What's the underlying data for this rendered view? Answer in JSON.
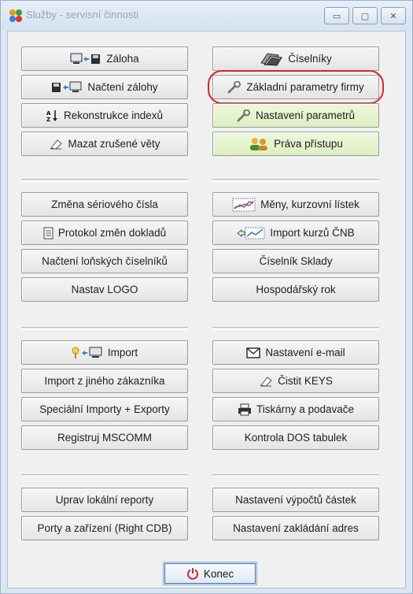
{
  "window": {
    "title": "Služby - servisní činnosti",
    "controls": {
      "minimize": "▭",
      "maximize": "▢",
      "close": "✕"
    }
  },
  "left_buttons": [
    {
      "name": "zaloha-button",
      "label": "Záloha",
      "icon": "computer-to-disk-icon"
    },
    {
      "name": "nacteni-zalohy-button",
      "label": "Načtení zálohy",
      "icon": "disk-to-computer-icon"
    },
    {
      "name": "rekonstrukce-indexu-button",
      "label": "Rekonstrukce indexů",
      "icon": "sort-az-icon"
    },
    {
      "name": "mazat-zrusene-vety-button",
      "label": "Mazat zrušené věty",
      "icon": "eraser-icon"
    },
    {
      "name": "zmena-serioveho-cisla-button",
      "label": "Změna sériového čísla",
      "icon": ""
    },
    {
      "name": "protokol-zmen-dokladu-button",
      "label": "Protokol změn dokladů",
      "icon": "document-icon"
    },
    {
      "name": "nacteni-lonskych-ciselniku-button",
      "label": "Načtení loňských číselníků",
      "icon": ""
    },
    {
      "name": "nastav-logo-button",
      "label": "Nastav LOGO",
      "icon": ""
    },
    {
      "name": "import-button",
      "label": "Import",
      "icon": "key-computer-icon"
    },
    {
      "name": "import-z-jineho-zakaznika-button",
      "label": "Import z jiného zákazníka",
      "icon": ""
    },
    {
      "name": "specialni-importy-exporty-button",
      "label": "Speciální Importy + Exporty",
      "icon": ""
    },
    {
      "name": "registruj-mscomm-button",
      "label": "Registruj MSCOMM",
      "icon": ""
    },
    {
      "name": "uprav-lokalni-reporty-button",
      "label": "Uprav lokální reporty",
      "icon": ""
    },
    {
      "name": "porty-a-zarizeni-button",
      "label": "Porty a zařízení (Right CDB)",
      "icon": ""
    }
  ],
  "right_buttons": [
    {
      "name": "ciselniky-button",
      "label": "Číselníky",
      "icon": "books-icon",
      "style": "plain"
    },
    {
      "name": "zakladni-parametry-firmy-button",
      "label": "Základní parametry firmy",
      "icon": "wrench-icon",
      "style": "plain",
      "highlighted": true
    },
    {
      "name": "nastaveni-parametru-button",
      "label": "Nastavení parametrů",
      "icon": "wrench-icon",
      "style": "green"
    },
    {
      "name": "prava-pristupu-button",
      "label": "Práva přístupu",
      "icon": "users-icon",
      "style": "green"
    },
    {
      "name": "meny-kurzovni-listek-button",
      "label": "Měny, kurzovní lístek",
      "icon": "chart-icon",
      "style": "plain"
    },
    {
      "name": "import-kurzu-cnb-button",
      "label": "Import kurzů ČNB",
      "icon": "chart-import-icon",
      "style": "plain"
    },
    {
      "name": "ciselnik-sklady-button",
      "label": "Číselník Sklady",
      "icon": "",
      "style": "plain"
    },
    {
      "name": "hospodarsky-rok-button",
      "label": "Hospodářský rok",
      "icon": "",
      "style": "plain"
    },
    {
      "name": "nastaveni-email-button",
      "label": "Nastavení e-mail",
      "icon": "envelope-icon",
      "style": "plain"
    },
    {
      "name": "cistit-keys-button",
      "label": "Čistit KEYS",
      "icon": "eraser-icon",
      "style": "plain"
    },
    {
      "name": "tiskarny-a-podavace-button",
      "label": "Tiskárny a podavače",
      "icon": "printer-icon",
      "style": "plain"
    },
    {
      "name": "kontrola-dos-tabulek-button",
      "label": "Kontrola DOS tabulek",
      "icon": "",
      "style": "plain"
    },
    {
      "name": "nastaveni-vypoctu-castek-button",
      "label": "Nastavení výpočtů částek",
      "icon": "",
      "style": "plain"
    },
    {
      "name": "nastaveni-zakladani-adres-button",
      "label": "Nastavení zakládání adres",
      "icon": "",
      "style": "plain"
    }
  ],
  "konec": {
    "label": "Konec",
    "icon": "power-icon",
    "icon_color": "#d8242e"
  },
  "colors": {
    "highlight_ring": "#d8242e",
    "green_button": "#ddefc1"
  }
}
